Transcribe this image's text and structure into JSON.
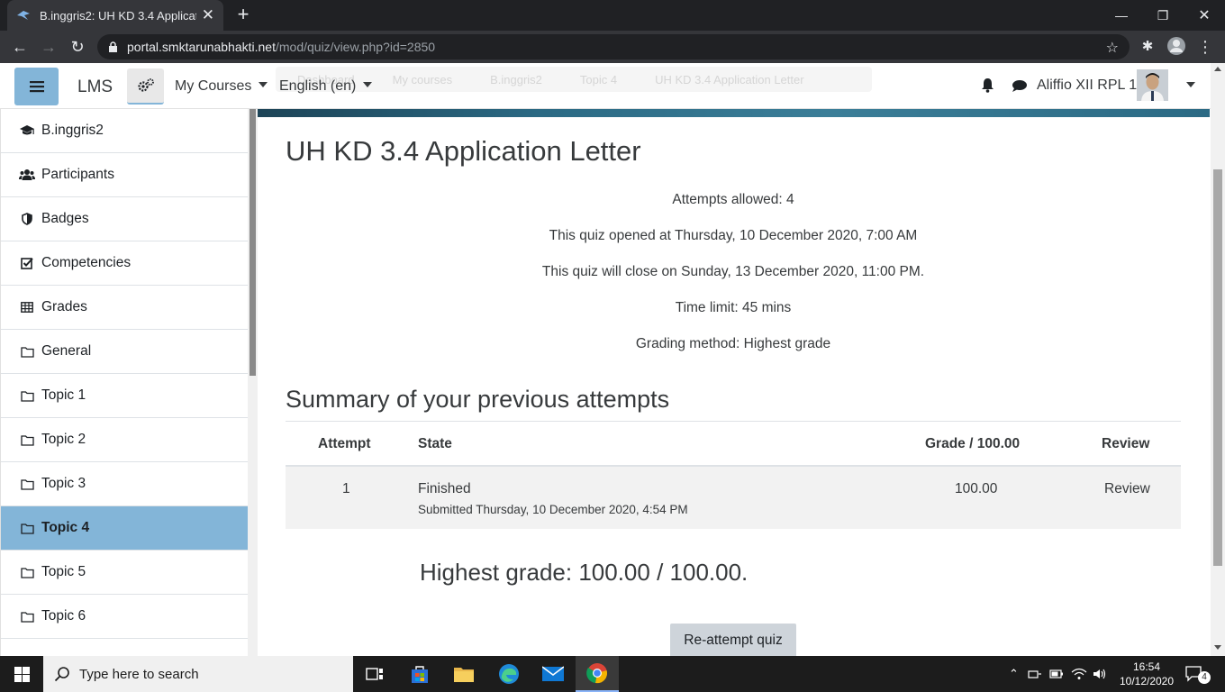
{
  "browser": {
    "tab_title": "B.inggris2: UH KD 3.4 Application Letter",
    "url_host": "portal.smktarunabhakti.net",
    "url_path": "/mod/quiz/view.php?id=2850"
  },
  "navbar": {
    "brand": "LMS",
    "my_courses": "My Courses",
    "language": "English (en)",
    "username": "Aliffio XII RPL 1",
    "breadcrumbs": [
      "Dashboard",
      "My courses",
      "B.inggris2",
      "Topic 4",
      "UH KD 3.4 Application Letter"
    ]
  },
  "sidebar": {
    "items": [
      {
        "label": "B.inggris2",
        "icon": "graduation-cap-icon"
      },
      {
        "label": "Participants",
        "icon": "users-icon"
      },
      {
        "label": "Badges",
        "icon": "shield-icon"
      },
      {
        "label": "Competencies",
        "icon": "checkbox-icon"
      },
      {
        "label": "Grades",
        "icon": "table-icon"
      },
      {
        "label": "General",
        "icon": "folder-icon"
      },
      {
        "label": "Topic 1",
        "icon": "folder-icon"
      },
      {
        "label": "Topic 2",
        "icon": "folder-icon"
      },
      {
        "label": "Topic 3",
        "icon": "folder-icon"
      },
      {
        "label": "Topic 4",
        "icon": "folder-icon"
      },
      {
        "label": "Topic 5",
        "icon": "folder-icon"
      },
      {
        "label": "Topic 6",
        "icon": "folder-icon"
      }
    ]
  },
  "main": {
    "title": "UH KD 3.4 Application Letter",
    "info": [
      "Attempts allowed: 4",
      "This quiz opened at Thursday, 10 December 2020, 7:00 AM",
      "This quiz will close on Sunday, 13 December 2020, 11:00 PM.",
      "Time limit: 45 mins",
      "Grading method: Highest grade"
    ],
    "summary_heading": "Summary of your previous attempts",
    "table": {
      "headers": {
        "attempt": "Attempt",
        "state": "State",
        "grade": "Grade / 100.00",
        "review": "Review"
      },
      "rows": [
        {
          "attempt": "1",
          "state": "Finished",
          "submitted": "Submitted Thursday, 10 December 2020, 4:54 PM",
          "grade": "100.00",
          "review": "Review"
        }
      ]
    },
    "highest_grade": "Highest grade: 100.00 / 100.00.",
    "reattempt_button": "Re-attempt quiz"
  },
  "taskbar": {
    "search_placeholder": "Type here to search",
    "time": "16:54",
    "date": "10/12/2020",
    "notification_count": "4"
  }
}
